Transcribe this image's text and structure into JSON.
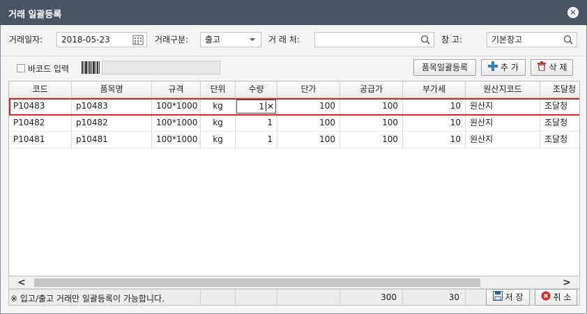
{
  "window": {
    "title": "거래 일괄등록",
    "close_icon": "close-icon"
  },
  "filters": {
    "date_label": "거래일자:",
    "date_value": "2018-05-23",
    "type_label": "거래구분:",
    "type_value": "출고",
    "partner_label": "거 래 처:",
    "partner_value": "",
    "warehouse_label": "창   고:",
    "warehouse_value": "기본창고"
  },
  "toolbar": {
    "barcode_label": "바코드 입력",
    "barcode_value": "",
    "bulk_register_label": "품목일괄등록",
    "add_label": "추 가",
    "delete_label": "삭 제"
  },
  "table": {
    "columns": [
      "코드",
      "품목명",
      "규격",
      "단위",
      "수량",
      "단가",
      "공급가",
      "부가세",
      "원산지코드",
      "조달청"
    ],
    "rows": [
      [
        "P10483",
        "p10483",
        "100*1000",
        "kg",
        "1",
        "100",
        "100",
        "10",
        "원산지",
        "조달청"
      ],
      [
        "P10482",
        "p10482",
        "100*1000",
        "kg",
        "1",
        "100",
        "100",
        "10",
        "원산지",
        "조달청"
      ],
      [
        "P10481",
        "p10481",
        "100*1000",
        "kg",
        "1",
        "100",
        "100",
        "10",
        "원산지",
        "조달청"
      ]
    ],
    "editing_value": "1",
    "totals": {
      "supply": "300",
      "vat": "30"
    }
  },
  "footer": {
    "note": "※ 입고/출고 거래만 일괄등록이 가능합니다.",
    "save_label": "저 장",
    "cancel_label": "취 소"
  },
  "colors": {
    "titlebar": "#4b5561",
    "selected_row_outline": "#d9262a",
    "add_icon": "#2f7fd1",
    "cancel_icon": "#d9262a"
  }
}
